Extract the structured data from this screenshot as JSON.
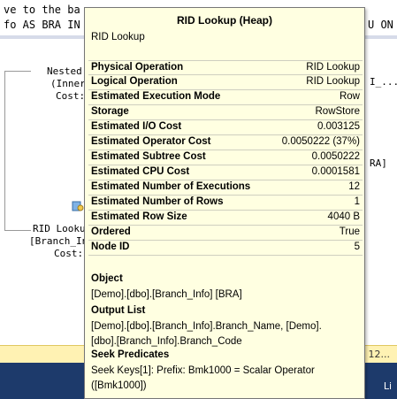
{
  "background": {
    "code_lines": [
      "ve to the ba",
      "fo AS BRA IN"
    ],
    "code_tail_right": "U ON",
    "plan_texts": {
      "nested_loops": [
        "Nested",
        "(Inner",
        "Cost:"
      ],
      "rid_lookup": [
        "RID Lookup",
        "[Branch_In",
        "Cost:"
      ],
      "right_fragment_1": "I_...",
      "right_fragment_2": "RA]"
    },
    "status_strip_text": "12...",
    "taskbar_text": "Li"
  },
  "tooltip": {
    "title": "RID Lookup (Heap)",
    "subtitle": "RID Lookup",
    "properties": [
      {
        "label": "Physical Operation",
        "value": "RID Lookup"
      },
      {
        "label": "Logical Operation",
        "value": "RID Lookup"
      },
      {
        "label": "Estimated Execution Mode",
        "value": "Row"
      },
      {
        "label": "Storage",
        "value": "RowStore"
      },
      {
        "label": "Estimated I/O Cost",
        "value": "0.003125"
      },
      {
        "label": "Estimated Operator Cost",
        "value": "0.0050222 (37%)"
      },
      {
        "label": "Estimated Subtree Cost",
        "value": "0.0050222"
      },
      {
        "label": "Estimated CPU Cost",
        "value": "0.0001581"
      },
      {
        "label": "Estimated Number of Executions",
        "value": "12"
      },
      {
        "label": "Estimated Number of Rows",
        "value": "1"
      },
      {
        "label": "Estimated Row Size",
        "value": "4040 B"
      },
      {
        "label": "Ordered",
        "value": "True"
      },
      {
        "label": "Node ID",
        "value": "5"
      }
    ],
    "object": {
      "heading": "Object",
      "lines": [
        "[Demo].[dbo].[Branch_Info] [BRA]"
      ]
    },
    "output_list": {
      "heading": "Output List",
      "lines": [
        "[Demo].[dbo].[Branch_Info].Branch_Name, [Demo].",
        "[dbo].[Branch_Info].Branch_Code"
      ]
    },
    "seek_predicates": {
      "heading": "Seek Predicates",
      "lines": [
        "Seek Keys[1]: Prefix: Bmk1000 = Scalar Operator",
        "([Bmk1000])"
      ]
    }
  }
}
